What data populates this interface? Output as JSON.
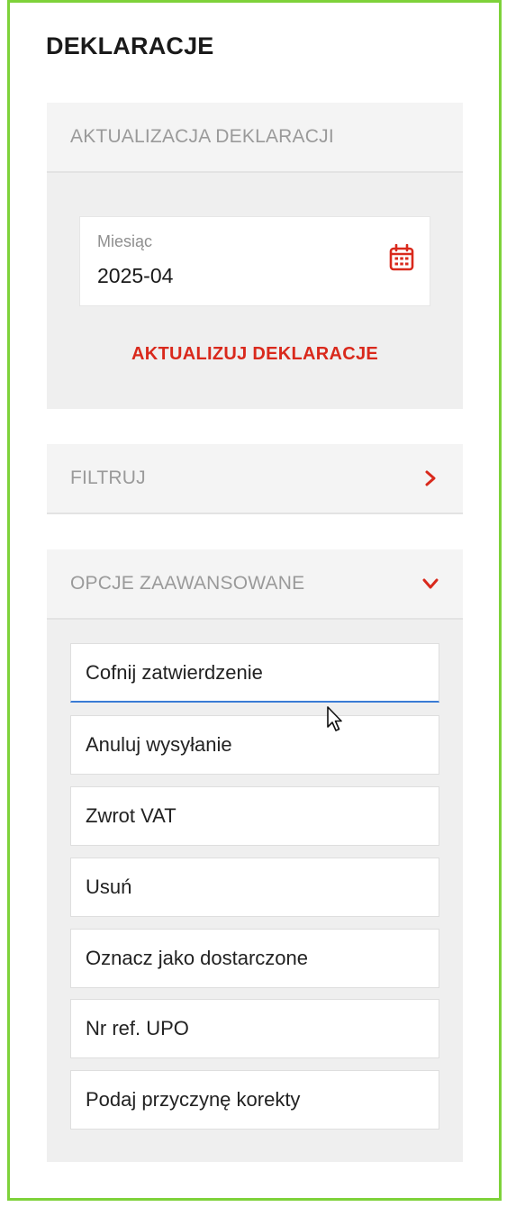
{
  "page": {
    "title": "DEKLARACJE"
  },
  "update_section": {
    "header": "AKTUALIZACJA DEKLARACJI",
    "month_label": "Miesiąc",
    "month_value": "2025-04",
    "calendar_icon": "calendar-icon",
    "update_button": "AKTUALIZUJ DEKLARACJE"
  },
  "filter_section": {
    "header": "FILTRUJ",
    "chevron_icon": "chevron-right-icon",
    "expanded": false
  },
  "advanced_section": {
    "header": "OPCJE ZAAWANSOWANE",
    "chevron_icon": "chevron-down-icon",
    "expanded": true,
    "options": [
      {
        "label": "Cofnij zatwierdzenie"
      },
      {
        "label": "Anuluj wysyłanie"
      },
      {
        "label": "Zwrot VAT"
      },
      {
        "label": "Usuń"
      },
      {
        "label": "Oznacz jako dostarczone"
      },
      {
        "label": "Nr ref. UPO"
      },
      {
        "label": "Podaj przyczynę korekty"
      }
    ]
  },
  "colors": {
    "accent_red": "#d9291c",
    "frame_green": "#7ed23a",
    "focus_blue": "#3a7bd5",
    "section_bg": "#efefef"
  }
}
